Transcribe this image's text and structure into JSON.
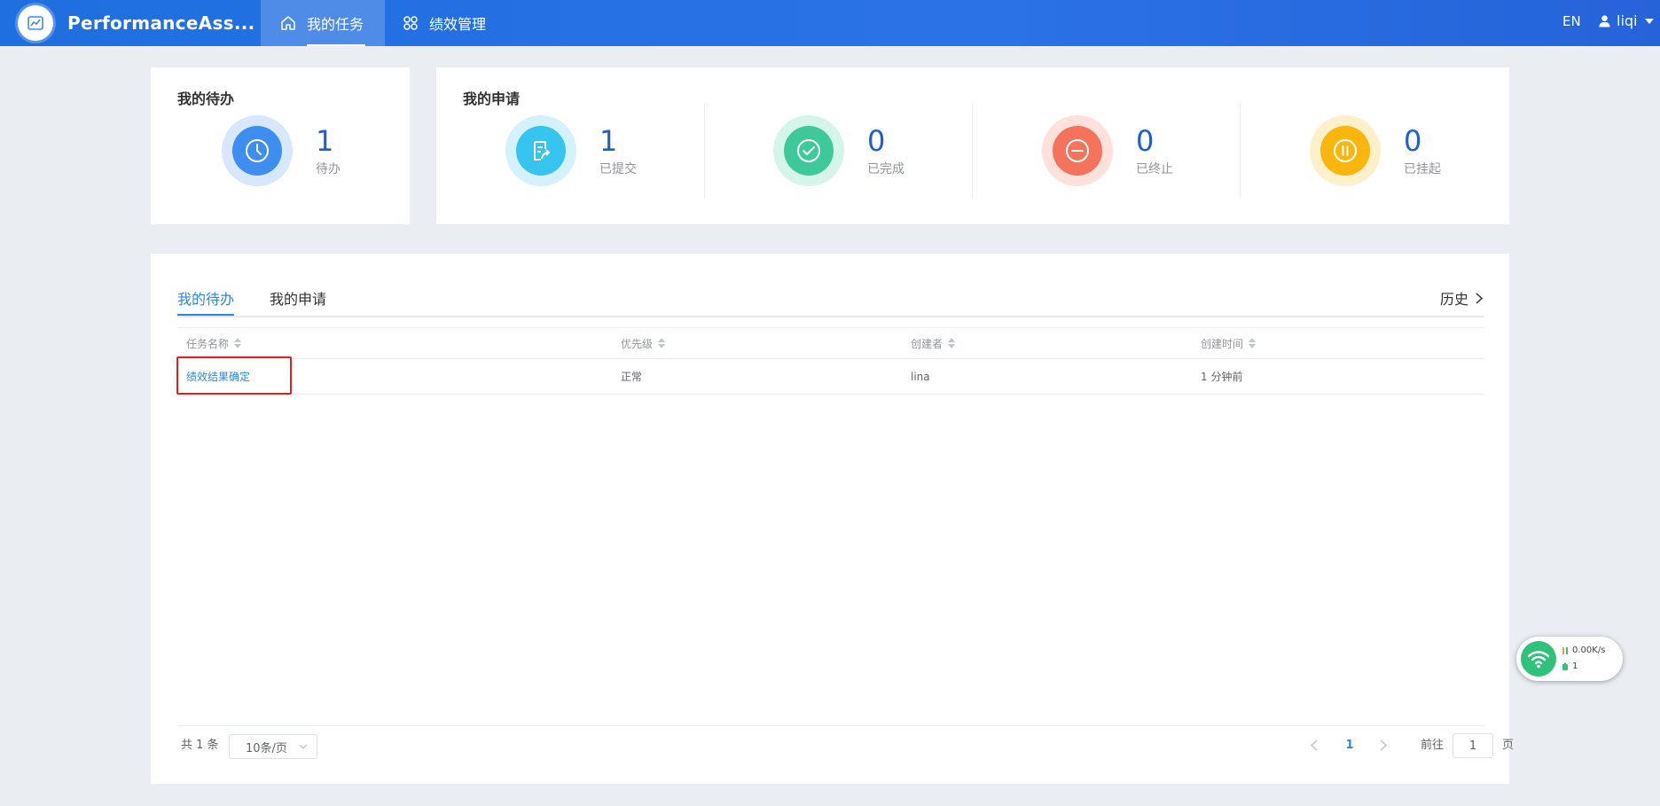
{
  "app": {
    "name": "PerformanceAss..."
  },
  "nav": {
    "items": [
      {
        "label": "我的任务",
        "icon": "home-icon",
        "active": true
      },
      {
        "label": "绩效管理",
        "icon": "apps-icon",
        "active": false
      }
    ]
  },
  "header": {
    "lang": "EN",
    "user": "liqi"
  },
  "todo_card": {
    "title": "我的待办",
    "stat": {
      "value": "1",
      "label": "待办",
      "icon": "clock-icon",
      "color": "#3d8ef0"
    }
  },
  "apply_card": {
    "title": "我的申请",
    "stats": [
      {
        "value": "1",
        "label": "已提交",
        "icon": "submit-icon",
        "color": "#37c4ee"
      },
      {
        "value": "0",
        "label": "已完成",
        "icon": "check-icon",
        "color": "#3ec99b"
      },
      {
        "value": "0",
        "label": "已终止",
        "icon": "minus-icon",
        "color": "#f5735a"
      },
      {
        "value": "0",
        "label": "已挂起",
        "icon": "pause-icon",
        "color": "#fbb60d"
      }
    ]
  },
  "tabs": [
    {
      "label": "我的待办",
      "active": true
    },
    {
      "label": "我的申请",
      "active": false
    }
  ],
  "history_label": "历史",
  "table": {
    "columns": [
      "任务名称",
      "优先级",
      "创建者",
      "创建时间"
    ],
    "rows": [
      {
        "name": "绩效结果确定",
        "priority": "正常",
        "creator": "lina",
        "created": "1 分钟前"
      }
    ]
  },
  "pagination": {
    "total_text": "共 1 条",
    "page_size": "10条/页",
    "current_page": "1",
    "goto_label": "前往",
    "goto_value": "1",
    "goto_suffix": "页"
  },
  "network_widget": {
    "speed": "0.00K/s",
    "count": "1"
  },
  "colors": {
    "accent": "#2e86de",
    "topbar": "#2b72e6",
    "highlight": "#e02020"
  }
}
